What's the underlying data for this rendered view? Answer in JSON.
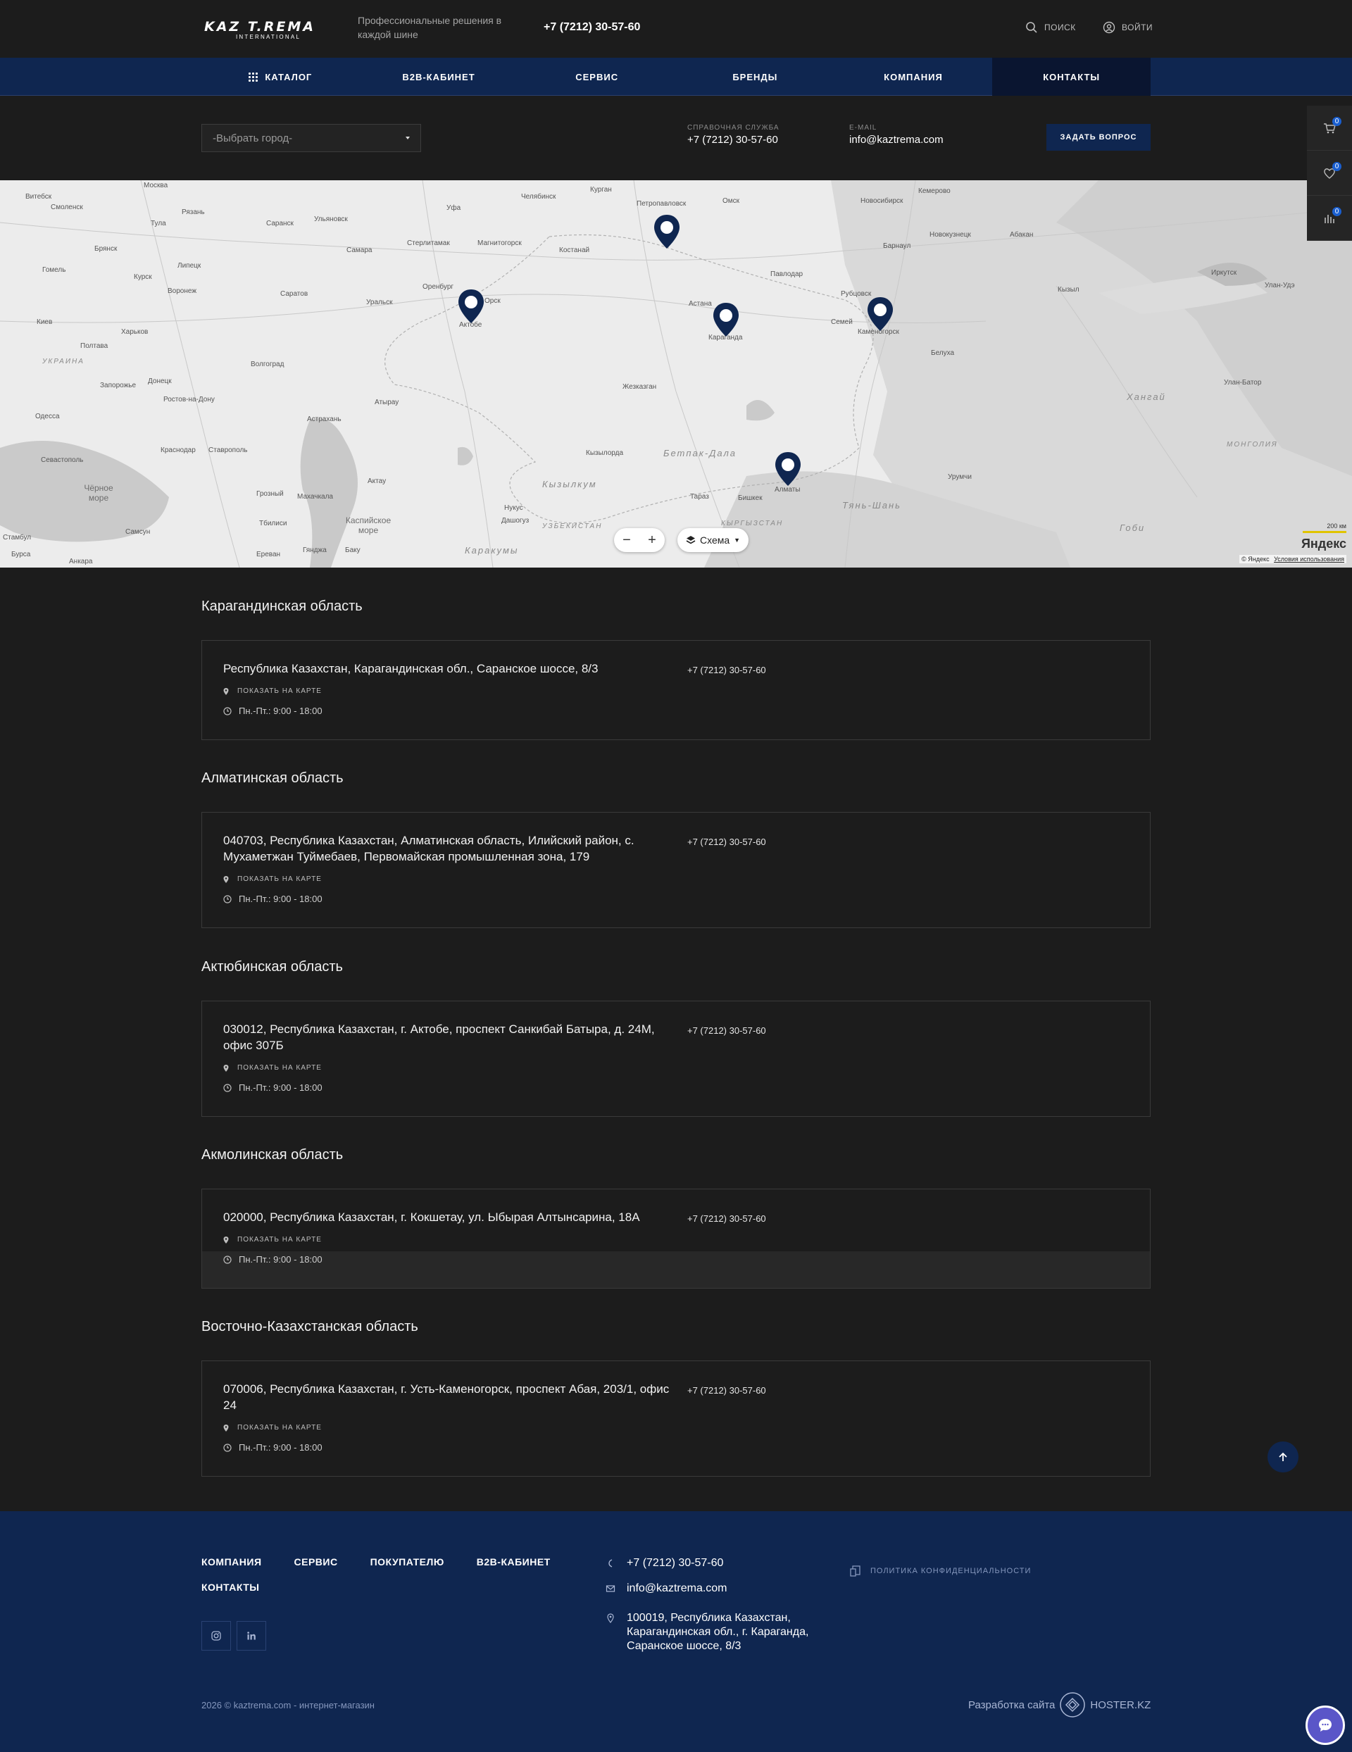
{
  "header": {
    "logo_main": "KAZ T.REMA",
    "logo_sub": "INTERNATIONAL",
    "tagline": "Профессиональные решения в каждой шине",
    "phone": "+7 (7212) 30-57-60",
    "search_label": "поиск",
    "login_label": "войти"
  },
  "nav": {
    "items": [
      {
        "label": "КАТАЛОГ"
      },
      {
        "label": "B2B-КАБИНЕТ"
      },
      {
        "label": "СЕРВИС"
      },
      {
        "label": "БРЕНДЫ"
      },
      {
        "label": "КОМПАНИЯ"
      },
      {
        "label": "КОНТАКТЫ"
      }
    ],
    "active_index": 5
  },
  "contact_bar": {
    "city_placeholder": "-Выбрать город-",
    "help_label": "СПРАВОЧНАЯ СЛУЖБА",
    "help_phone": "+7 (7212) 30-57-60",
    "email_label": "E-MAIL",
    "email": "info@kaztrema.com",
    "ask_button": "ЗАДАТЬ ВОПРОС"
  },
  "side_panel": {
    "cart_count": "0",
    "favorites_count": "0",
    "compare_count": "0"
  },
  "map": {
    "cities": [
      "Витебск",
      "Смоленск",
      "Москва",
      "Рязань",
      "Тула",
      "Брянск",
      "Липецк",
      "Воронеж",
      "Курск",
      "Гомель",
      "Киев",
      "Харьков",
      "Полтава",
      "Запорожье",
      "Донецк",
      "Ростов-на-Дону",
      "Одесса",
      "Севастополь",
      "Краснодар",
      "Ставрополь",
      "Грозный",
      "Махачкала",
      "Тбилиси",
      "Ереван",
      "Баку",
      "Самсун",
      "Стамбул",
      "Бурса",
      "Анкара",
      "Волгоград",
      "Саратов",
      "Самара",
      "Саранск",
      "Ульяновск",
      "Уфа",
      "Челябинск",
      "Стерлитамак",
      "Магнитогорск",
      "Оренбург",
      "Орск",
      "Уральск",
      "Актобе",
      "Атырау",
      "Астрахань",
      "Актау",
      "Курган",
      "Петропавловск",
      "Омск",
      "Костанай",
      "Павлодар",
      "Астана",
      "Караганда",
      "Жезказган",
      "Кызылорда",
      "Тараз",
      "Бишкек",
      "Алматы",
      "Нукус",
      "Дашогуз",
      "Новосибирск",
      "Кемерово",
      "Барнаул",
      "Новокузнецк",
      "Абакан",
      "Рубцовск",
      "Семей",
      "Каменогорск",
      "Белуха",
      "Кызыл",
      "Иркутск",
      "Улан-Удэ",
      "Улан-Батор",
      "Урумчи",
      "Гянджа"
    ],
    "regions": [
      "Бетпак-Дала",
      "Кызылкум",
      "Каракумы",
      "УЗБЕКИСТАН",
      "КЫРГЫЗСТАН",
      "УКРАИНА",
      "МОНГОЛИЯ",
      "Хангай",
      "Тянь-Шань",
      "Гоби"
    ],
    "seas": [
      "Чёрное море",
      "Каспийское море"
    ],
    "zoom_out": "−",
    "zoom_in": "+",
    "scheme_label": "Схема",
    "scale_label": "200 км",
    "yandex_brand": "Яндекс",
    "copyright": "© Яндекс",
    "terms": "Условия использования"
  },
  "locations": [
    {
      "region": "Карагандинская область",
      "address": "Республика Казахстан, Карагандинская обл., Саранское шоссе, 8/3",
      "phone": "+7 (7212) 30-57-60",
      "show_map": "ПОКАЗАТЬ НА КАРТЕ",
      "hours": "Пн.-Пт.: 9:00 - 18:00"
    },
    {
      "region": "Алматинская область",
      "address": "040703, Республика Казахстан, Алматинская область, Илийский район, с. Мухаметжан Туймебаев, Первомайская промышленная зона, 179",
      "phone": "+7 (7212) 30-57-60",
      "show_map": "ПОКАЗАТЬ НА КАРТЕ",
      "hours": "Пн.-Пт.: 9:00 - 18:00"
    },
    {
      "region": "Актюбинская область",
      "address": "030012, Республика Казахстан, г. Актобе, проспект Санкибай Батыра, д. 24М, офис 307Б",
      "phone": "+7 (7212) 30-57-60",
      "show_map": "ПОКАЗАТЬ НА КАРТЕ",
      "hours": "Пн.-Пт.: 9:00 - 18:00"
    },
    {
      "region": "Акмолинская область",
      "address": "020000, Республика Казахстан, г. Кокшетау, ул. Ыбырая Алтынсарина, 18А",
      "phone": "+7 (7212) 30-57-60",
      "show_map": "ПОКАЗАТЬ НА КАРТЕ",
      "hours": "Пн.-Пт.: 9:00 - 18:00"
    },
    {
      "region": "Восточно-Казахстанская область",
      "address": "070006, Республика Казахстан, г. Усть-Каменогорск, проспект Абая, 203/1, офис 24",
      "phone": "+7 (7212) 30-57-60",
      "show_map": "ПОКАЗАТЬ НА КАРТЕ",
      "hours": "Пн.-Пт.: 9:00 - 18:00"
    }
  ],
  "footer": {
    "nav": [
      "КОМПАНИЯ",
      "СЕРВИС",
      "ПОКУПАТЕЛЮ",
      "B2B-КАБИНЕТ",
      "КОНТАКТЫ"
    ],
    "phone": "+7 (7212) 30-57-60",
    "email": "info@kaztrema.com",
    "address": "100019, Республика Казахстан, Карагандинская обл., г. Караганда, Саранское шоссе, 8/3",
    "policy": "ПОЛИТИКА КОНФИДЕНЦИАЛЬНОСТИ",
    "copyright": "2026 © kaztrema.com - интернет-магазин",
    "dev_label": "Разработка сайта",
    "dev_brand": "HOSTER.KZ"
  },
  "colors": {
    "navy": "#0f2650",
    "dark_bg": "#1c1c1c",
    "active_nav": "#0a1530",
    "pin": "#0f2650"
  }
}
